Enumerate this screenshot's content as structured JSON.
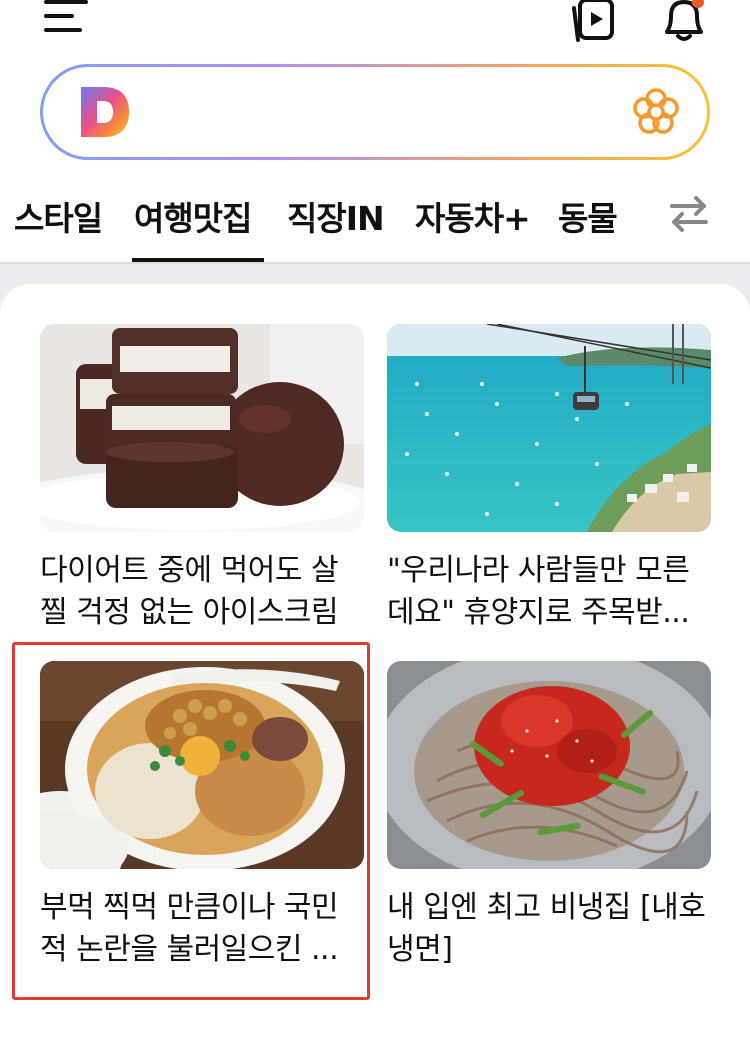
{
  "header": {
    "menu_icon": "hamburger-menu-icon",
    "video_icon": "video-play-icon",
    "bell_icon": "notification-bell-icon",
    "notification_dot_color": "#f25a2b"
  },
  "search": {
    "logo": "daum-d-logo",
    "flower_icon": "flower-icon",
    "gradient": [
      "#7fa0f2",
      "#b58ff0",
      "#f0a36a",
      "#f6c233"
    ]
  },
  "tabs": [
    {
      "label": "스타일"
    },
    {
      "label": "여행맛집",
      "active": true
    },
    {
      "label": "직장IN"
    },
    {
      "label": "자동차+"
    },
    {
      "label": "동물"
    }
  ],
  "tabs_more_icon": "swap-arrows-icon",
  "cards": [
    {
      "title": "다이어트 중에 먹어도 살 찔 걱정 없는 아이스크림",
      "image": "chocolate-ice-cream-bars"
    },
    {
      "title": "\"우리나라 사람들만 모른데요\" 휴양지로 주목받...",
      "image": "cable-car-over-turquoise-bay"
    },
    {
      "title": "부먹 찍먹 만큼이나 국민적 논란을 불러일으킨 ...",
      "image": "noodle-bowl-with-toppings",
      "highlighted": true
    },
    {
      "title": "내 입엔 최고 비냉집 [내호냉면]",
      "image": "spicy-cold-noodles"
    }
  ]
}
